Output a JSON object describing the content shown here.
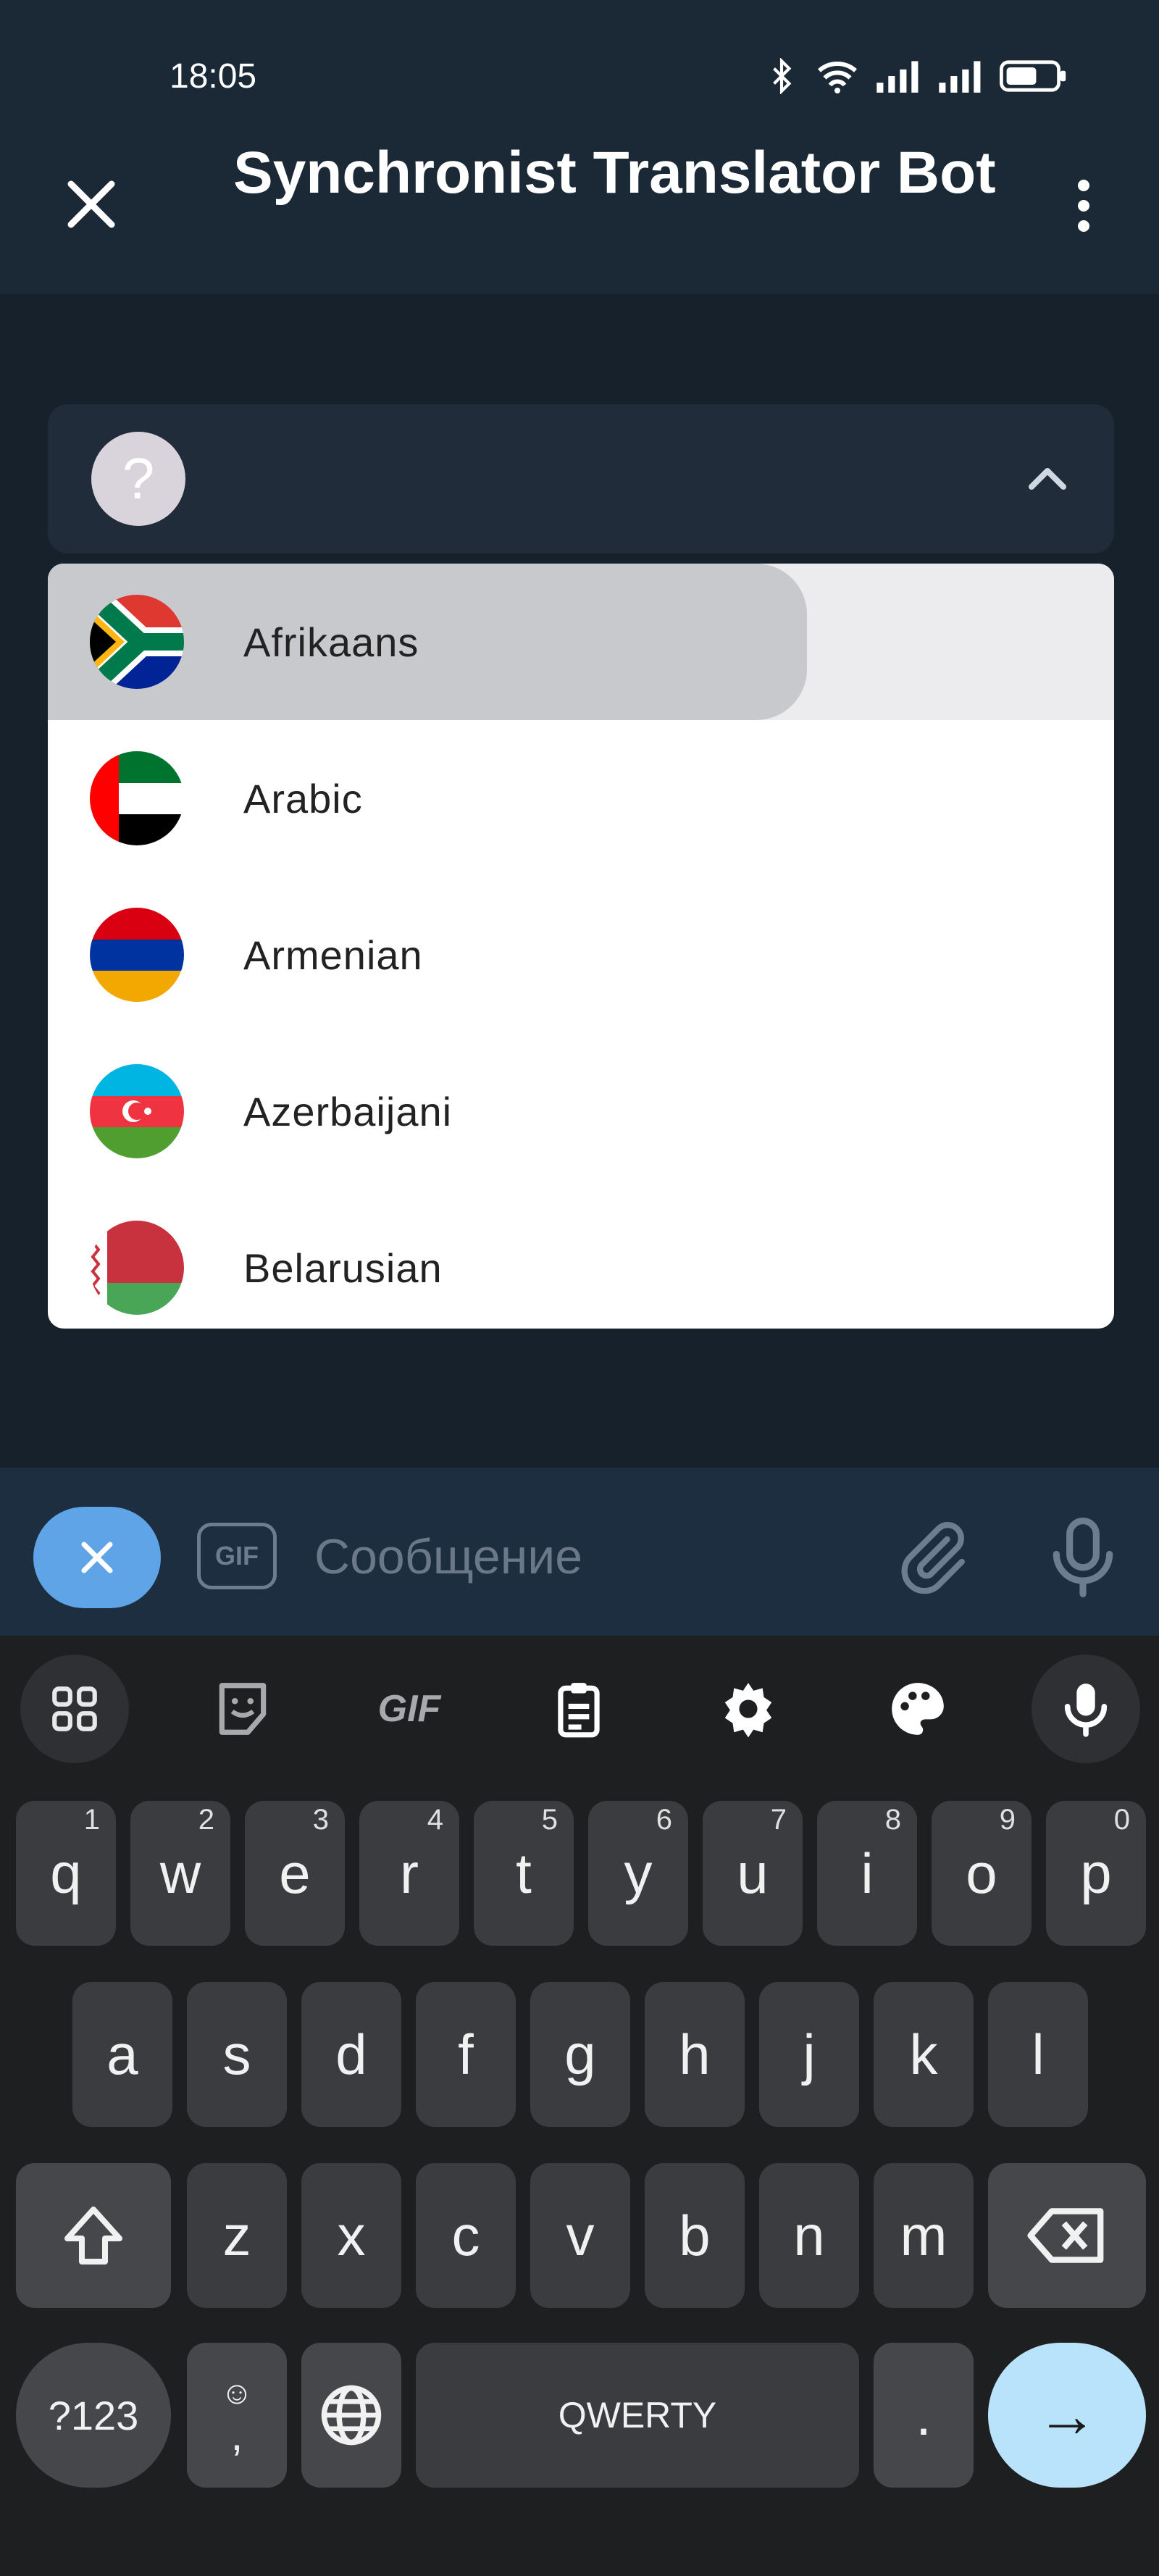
{
  "status_bar": {
    "time": "18:05",
    "icons": [
      "bluetooth-icon",
      "wifi-icon",
      "signal-icon",
      "signal-icon",
      "battery-icon"
    ]
  },
  "header": {
    "title": "Synchronist Translator Bot",
    "close_icon": "close-icon",
    "menu_icon": "more-vert-icon"
  },
  "language_select": {
    "selected_avatar": "?",
    "chevron_icon": "chevron-up-icon"
  },
  "languages": [
    {
      "label": "Afrikaans",
      "flag": "za-flag-icon",
      "hovered": true
    },
    {
      "label": "Arabic",
      "flag": "ae-flag-icon"
    },
    {
      "label": "Armenian",
      "flag": "am-flag-icon"
    },
    {
      "label": "Azerbaijani",
      "flag": "az-flag-icon"
    },
    {
      "label": "Belarusian",
      "flag": "by-flag-icon"
    }
  ],
  "composer": {
    "placeholder": "Сообщение",
    "gif_label": "GIF"
  },
  "keyboard": {
    "toolbar": [
      "apps-icon",
      "sticker-icon",
      "GIF",
      "clipboard-icon",
      "settings-icon",
      "palette-icon",
      "mic-icon"
    ],
    "row1": [
      "q",
      "w",
      "e",
      "r",
      "t",
      "y",
      "u",
      "i",
      "o",
      "p"
    ],
    "row1_nums": [
      "1",
      "2",
      "3",
      "4",
      "5",
      "6",
      "7",
      "8",
      "9",
      "0"
    ],
    "row2": [
      "a",
      "s",
      "d",
      "f",
      "g",
      "h",
      "j",
      "k",
      "l"
    ],
    "row3": [
      "z",
      "x",
      "c",
      "v",
      "b",
      "n",
      "m"
    ],
    "sym_key": "?123",
    "emoji_comma": ",",
    "space_label": "QWERTY",
    "period": ".",
    "enter_icon": "→"
  },
  "colors": {
    "accent": "#5ea4e6",
    "background": "#17212b",
    "header": "#1b2836",
    "keyboard": "#1e1f21",
    "enter": "#b9e3fb"
  }
}
